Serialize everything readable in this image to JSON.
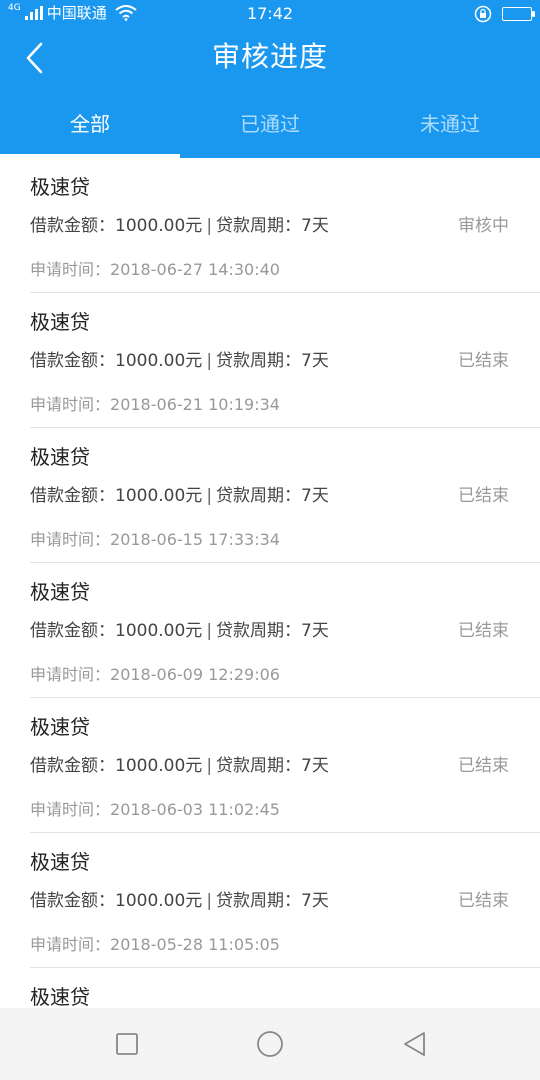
{
  "status_bar": {
    "network": "4G",
    "carrier": "中国联通",
    "time": "17:42"
  },
  "header": {
    "title": "审核进度",
    "back_icon": "chevron-left-icon"
  },
  "tabs": [
    {
      "label": "全部",
      "active": true
    },
    {
      "label": "已通过",
      "active": false
    },
    {
      "label": "未通过",
      "active": false
    }
  ],
  "labels": {
    "amount": "借款金额：",
    "period": "贷款周期：",
    "separator": "|",
    "apply_time": "申请时间："
  },
  "items": [
    {
      "product": "极速贷",
      "amount": "1000.00元",
      "period": "7天",
      "status": "审核中",
      "time": "2018-06-27 14:30:40"
    },
    {
      "product": "极速贷",
      "amount": "1000.00元",
      "period": "7天",
      "status": "已结束",
      "time": "2018-06-21 10:19:34"
    },
    {
      "product": "极速贷",
      "amount": "1000.00元",
      "period": "7天",
      "status": "已结束",
      "time": "2018-06-15 17:33:34"
    },
    {
      "product": "极速贷",
      "amount": "1000.00元",
      "period": "7天",
      "status": "已结束",
      "time": "2018-06-09 12:29:06"
    },
    {
      "product": "极速贷",
      "amount": "1000.00元",
      "period": "7天",
      "status": "已结束",
      "time": "2018-06-03 11:02:45"
    },
    {
      "product": "极速贷",
      "amount": "1000.00元",
      "period": "7天",
      "status": "已结束",
      "time": "2018-05-28 11:05:05"
    },
    {
      "product": "极速贷",
      "amount": "",
      "period": "",
      "status": "",
      "time": ""
    }
  ],
  "colors": {
    "primary": "#1a98f0",
    "muted": "#999999"
  }
}
